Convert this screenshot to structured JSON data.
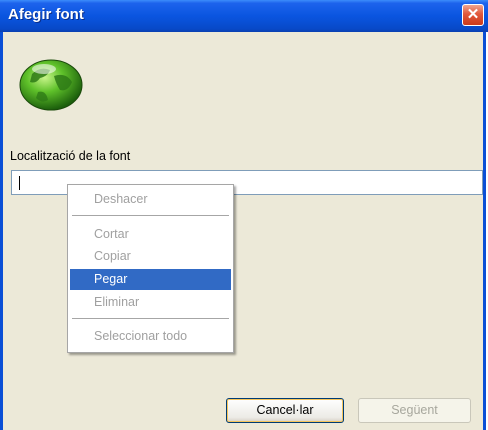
{
  "window": {
    "title": "Afegir font",
    "close_glyph": "✕"
  },
  "icon": "globe-icon",
  "location": {
    "label": "Localització de la font",
    "value": ""
  },
  "context_menu": {
    "items": [
      "Deshacer",
      "Cortar",
      "Copiar",
      "Pegar",
      "Eliminar",
      "Seleccionar todo"
    ],
    "selected": "Pegar"
  },
  "buttons": {
    "cancel": "Cancel·lar",
    "next": "Següent"
  },
  "colors": {
    "titlebar": "#0a55e0",
    "highlight": "#316ac5",
    "dialog_bg": "#ece9d8"
  }
}
